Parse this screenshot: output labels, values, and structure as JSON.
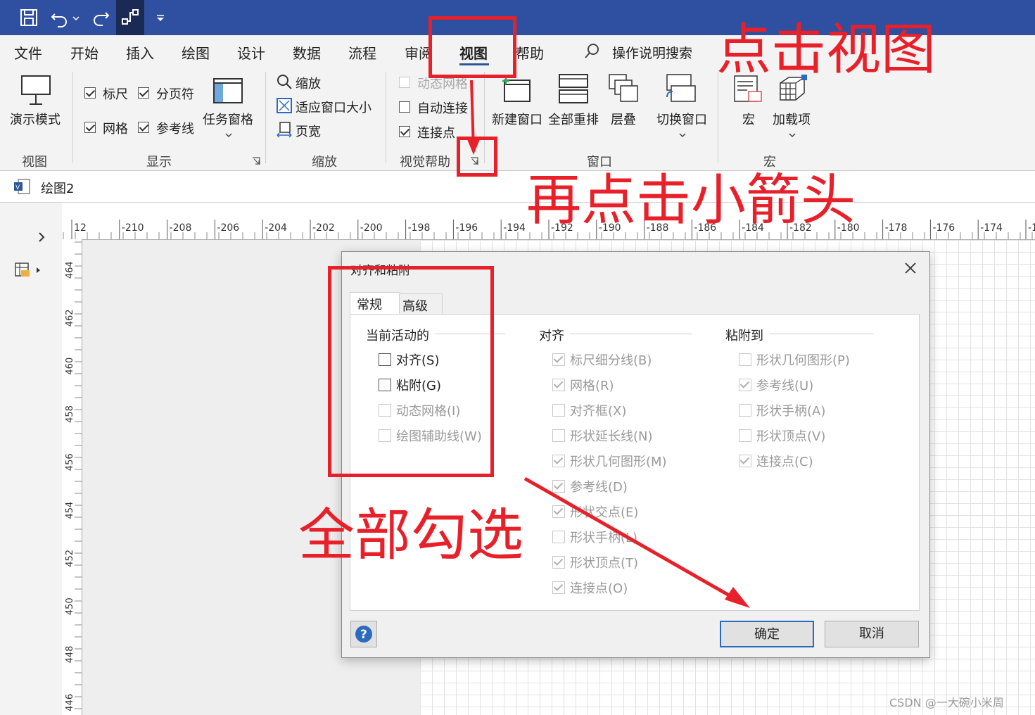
{
  "window": {
    "doc_tab": "绘图2"
  },
  "menu": [
    "文件",
    "开始",
    "插入",
    "绘图",
    "设计",
    "数据",
    "流程",
    "审阅",
    "视图",
    "帮助"
  ],
  "search_placeholder": "操作说明搜索",
  "ribbon": {
    "view_group": {
      "button": "演示模式",
      "label": "视图"
    },
    "show_group": {
      "ruler": "标尺",
      "page_breaks": "分页符",
      "grid": "网格",
      "guides": "参考线",
      "task_panes": "任务窗格",
      "label": "显示"
    },
    "zoom_group": {
      "zoom": "缩放",
      "fit_window": "适应窗口大小",
      "page_width": "页宽",
      "label": "缩放"
    },
    "visual_aids_group": {
      "dynamic_grid": "动态网格",
      "autoconnect": "自动连接",
      "connection_points": "连接点",
      "label": "视觉帮助"
    },
    "window_group": {
      "new_window": "新建窗口",
      "arrange_all": "全部重排",
      "cascade": "层叠",
      "switch_windows": "切换窗口",
      "label": "窗口"
    },
    "macros_group": {
      "macros": "宏",
      "addins": "加载项",
      "label": "宏"
    }
  },
  "ruler": {
    "h_ticks": [
      "12",
      "-210",
      "-208",
      "-206",
      "-204",
      "-202",
      "-200",
      "-198",
      "-196",
      "-194",
      "-192",
      "-190",
      "-188",
      "-186",
      "-184",
      "-182",
      "-180",
      "-178",
      "-176",
      "-174",
      "-1"
    ],
    "v_ticks": [
      "464",
      "462",
      "460",
      "458",
      "456",
      "454",
      "452",
      "450",
      "448",
      "446"
    ]
  },
  "dialog": {
    "title": "对齐和粘附",
    "tabs": [
      "常规",
      "高级"
    ],
    "active_section": {
      "title": "当前活动的",
      "items": [
        {
          "label": "对齐(S)",
          "checked": false,
          "disabled": false
        },
        {
          "label": "粘附(G)",
          "checked": false,
          "disabled": false
        },
        {
          "label": "动态网格(I)",
          "checked": false,
          "disabled": true
        },
        {
          "label": "绘图辅助线(W)",
          "checked": false,
          "disabled": true
        }
      ]
    },
    "snap_section": {
      "title": "对齐",
      "items": [
        {
          "label": "标尺细分线(B)",
          "checked": true
        },
        {
          "label": "网格(R)",
          "checked": true
        },
        {
          "label": "对齐框(X)",
          "checked": false
        },
        {
          "label": "形状延长线(N)",
          "checked": false
        },
        {
          "label": "形状几何图形(M)",
          "checked": true
        },
        {
          "label": "参考线(D)",
          "checked": true
        },
        {
          "label": "形状交点(E)",
          "checked": true
        },
        {
          "label": "形状手柄(L)",
          "checked": false
        },
        {
          "label": "形状顶点(T)",
          "checked": true
        },
        {
          "label": "连接点(O)",
          "checked": true
        }
      ]
    },
    "glue_section": {
      "title": "粘附到",
      "items": [
        {
          "label": "形状几何图形(P)",
          "checked": false
        },
        {
          "label": "参考线(U)",
          "checked": true
        },
        {
          "label": "形状手柄(A)",
          "checked": false
        },
        {
          "label": "形状顶点(V)",
          "checked": false
        },
        {
          "label": "连接点(C)",
          "checked": true
        }
      ]
    },
    "ok": "确定",
    "cancel": "取消"
  },
  "annotations": {
    "click_view": "点击视图",
    "click_arrow": "再点击小箭头",
    "select_all": "全部勾选"
  },
  "watermark": "CSDN @一大碗小米周",
  "colors": {
    "titlebar": "#2F4FA0",
    "annotation": "#E8202A",
    "accent_underline": "#2B579A",
    "primary_button_border": "#2B6BBF"
  }
}
